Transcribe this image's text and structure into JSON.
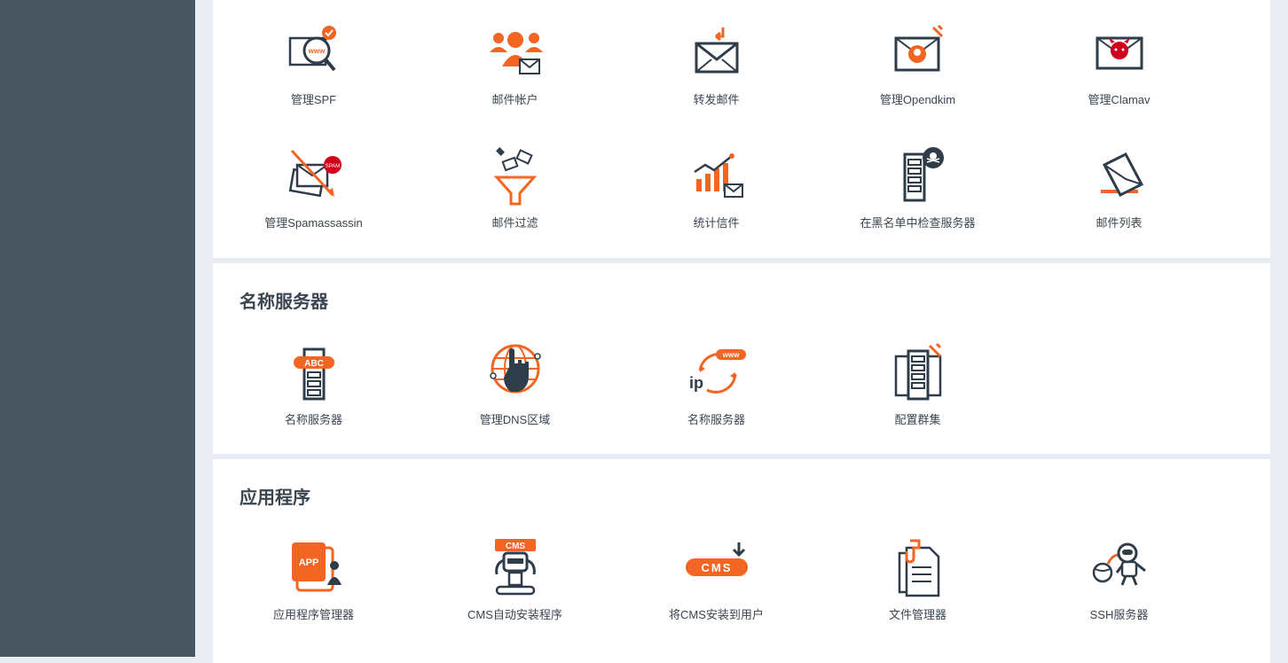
{
  "colors": {
    "accent": "#f26522",
    "dark": "#2f3d4a",
    "sidebar": "#48565f",
    "bg": "#e9edf3"
  },
  "mail_section": {
    "items": [
      {
        "label": "管理SPF",
        "icon": "www-magnifier-icon"
      },
      {
        "label": "邮件帐户",
        "icon": "users-mail-icon"
      },
      {
        "label": "转发邮件",
        "icon": "forward-mail-icon"
      },
      {
        "label": "管理Opendkim",
        "icon": "opendkim-mail-icon"
      },
      {
        "label": "管理Clamav",
        "icon": "clamav-devil-mail-icon"
      },
      {
        "label": "管理Spamassassin",
        "icon": "spam-mail-icon"
      },
      {
        "label": "邮件过滤",
        "icon": "mail-funnel-icon"
      },
      {
        "label": "统计信件",
        "icon": "mail-stats-icon"
      },
      {
        "label": "在黑名单中检查服务器",
        "icon": "blacklist-server-icon"
      },
      {
        "label": "邮件列表",
        "icon": "mail-list-icon"
      }
    ]
  },
  "nameserver_section": {
    "title": "名称服务器",
    "items": [
      {
        "label": "名称服务器",
        "icon": "abc-server-icon"
      },
      {
        "label": "管理DNS区域",
        "icon": "dns-globe-hand-icon"
      },
      {
        "label": "名称服务器",
        "icon": "ip-www-icon"
      },
      {
        "label": "配置群集",
        "icon": "cluster-servers-icon"
      }
    ]
  },
  "apps_section": {
    "title": "应用程序",
    "items": [
      {
        "label": "应用程序管理器",
        "icon": "app-manager-icon",
        "badge": "APP"
      },
      {
        "label": "CMS自动安装程序",
        "icon": "cms-robot-icon",
        "badge": "CMS"
      },
      {
        "label": "将CMS安装到用户",
        "icon": "cms-install-icon",
        "badge": "CMS"
      },
      {
        "label": "文件管理器",
        "icon": "file-manager-icon"
      },
      {
        "label": "SSH服务器",
        "icon": "ssh-astronaut-icon"
      }
    ]
  }
}
